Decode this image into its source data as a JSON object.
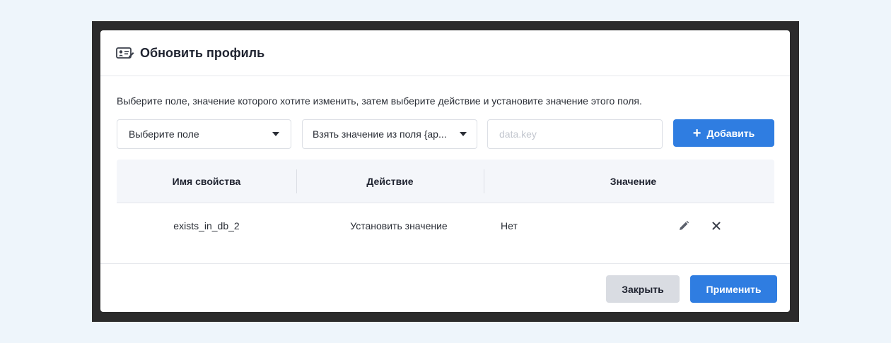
{
  "modal": {
    "title": "Обновить профиль",
    "hint": "Выберите поле, значение которого хотите изменить, затем выберите действие и установите значение этого поля."
  },
  "controls": {
    "field_select": "Выберите поле",
    "action_select": "Взять значение из поля {ap...",
    "value_placeholder": "data.key",
    "value": "",
    "add_label": "Добавить"
  },
  "table": {
    "columns": [
      "Имя свойства",
      "Действие",
      "Значение"
    ],
    "rows": [
      {
        "property": "exists_in_db_2",
        "action": "Установить значение",
        "value": "Нет"
      }
    ]
  },
  "footer": {
    "close_label": "Закрыть",
    "apply_label": "Применить"
  },
  "colors": {
    "accent": "#2f7de1",
    "secondary_button": "#d9dce2",
    "table_header_bg": "#f4f6fa"
  },
  "icons": {
    "title": "profile-card-icon",
    "add": "plus-icon",
    "caret": "caret-down-icon",
    "edit": "pencil-icon",
    "delete": "close-icon"
  }
}
